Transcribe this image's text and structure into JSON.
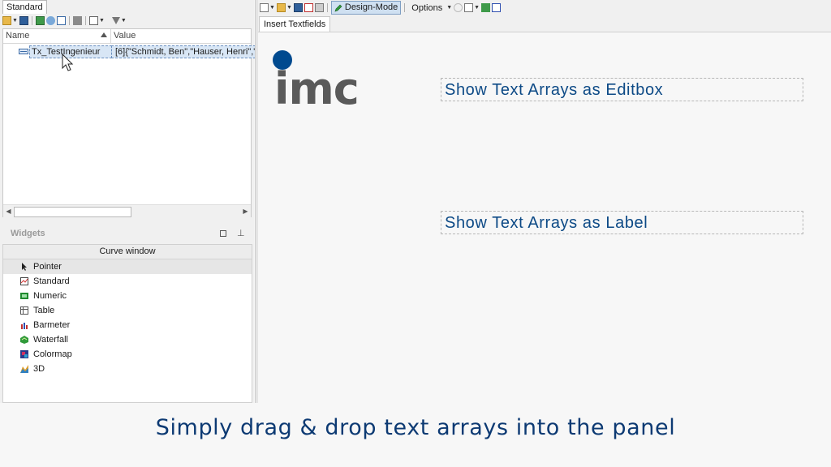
{
  "left_panel": {
    "tab_label": "Standard",
    "toolbar_icons": [
      "open-folder-icon",
      "save-icon",
      "import-icon",
      "clip-icon",
      "table-icon",
      "delete-icon",
      "view-icon",
      "filter-icon"
    ],
    "columns": {
      "name": "Name",
      "value": "Value"
    },
    "variable": {
      "name": "Tx_TestIngenieur",
      "value": "[6]{\"Schmidt, Ben\",\"Hauser, Henri\",\"M"
    },
    "widgets_title": "Widgets",
    "category": "Curve window",
    "widgets": [
      {
        "label": "Pointer",
        "icon": "pointer-icon"
      },
      {
        "label": "Standard",
        "icon": "standard-chart-icon"
      },
      {
        "label": "Numeric",
        "icon": "numeric-icon"
      },
      {
        "label": "Table",
        "icon": "table-icon"
      },
      {
        "label": "Barmeter",
        "icon": "barmeter-icon"
      },
      {
        "label": "Waterfall",
        "icon": "waterfall-icon"
      },
      {
        "label": "Colormap",
        "icon": "colormap-icon"
      },
      {
        "label": "3D",
        "icon": "3d-icon"
      }
    ]
  },
  "right_toolbar": {
    "design_mode_label": "Design-Mode",
    "options_label": "Options"
  },
  "panel": {
    "tab_label": "Insert Textfields",
    "logo_text": "imc",
    "textbox_editbox": "Show Text Arrays as Editbox",
    "textbox_label": "Show Text Arrays as Label"
  },
  "caption": "Simply drag & drop text arrays into the panel",
  "colors": {
    "accent": "#004a8f",
    "caption": "#0d3a73",
    "selection": "#d8e6f5"
  }
}
